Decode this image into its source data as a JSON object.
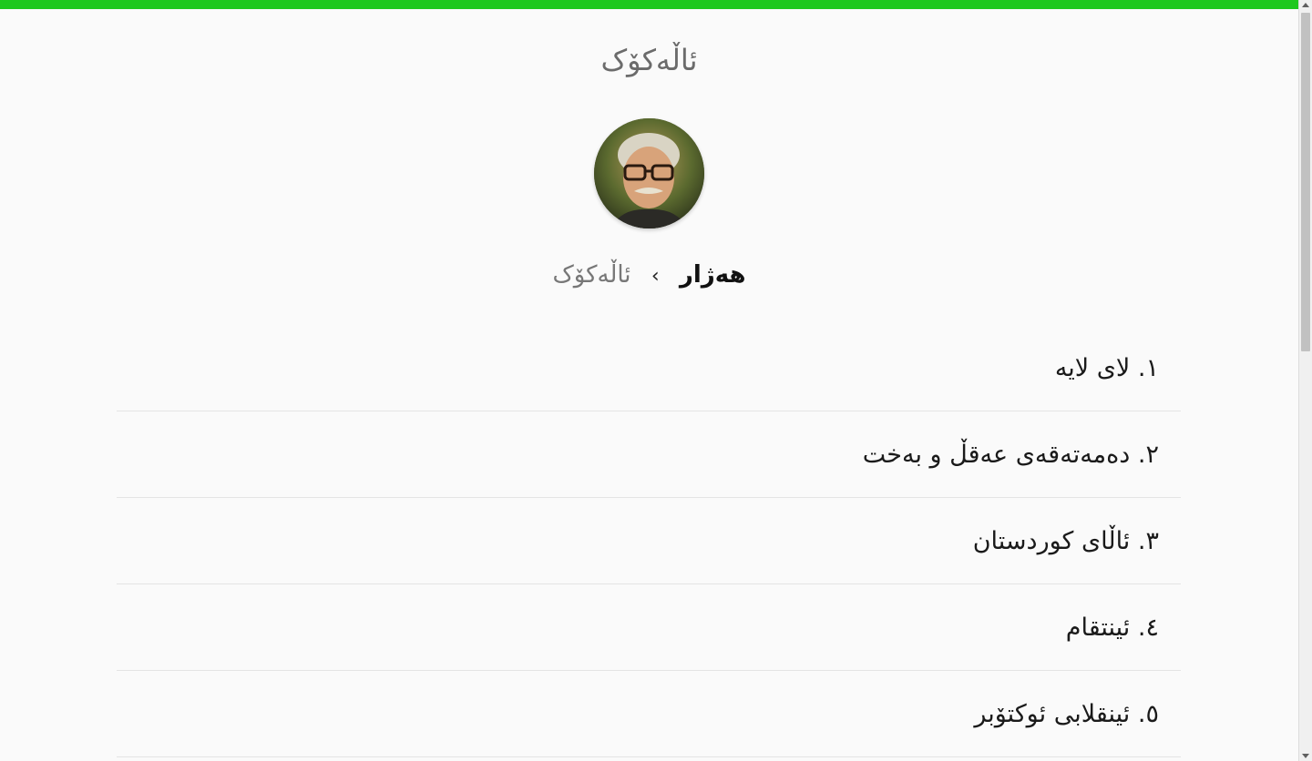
{
  "header": {
    "title": "ئاڵەکۆک"
  },
  "breadcrumb": {
    "parent": "هەژار",
    "separator": "›",
    "current": "ئاڵەکۆک"
  },
  "poems": [
    {
      "label": "١. لای لایە"
    },
    {
      "label": "٢. دەمەتەقەی عەقڵ و بەخت"
    },
    {
      "label": "٣. ئاڵای کوردستان"
    },
    {
      "label": "٤. ئینتقام"
    },
    {
      "label": "٥. ئینقلابی ئوکتۆبر"
    }
  ],
  "colors": {
    "accent_bar": "#1ec81e",
    "background": "#fafafa"
  },
  "avatar": {
    "icon": "poet-portrait"
  }
}
